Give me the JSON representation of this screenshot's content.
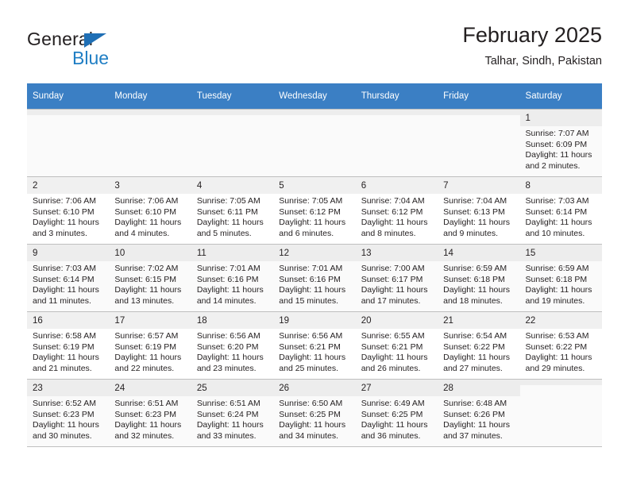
{
  "brand": {
    "name_part1": "General",
    "name_part2": "Blue",
    "logo_icon": "triangle-logo-icon"
  },
  "header": {
    "title": "February 2025",
    "subtitle": "Talhar, Sindh, Pakistan"
  },
  "calendar": {
    "weekday_headers": [
      "Sunday",
      "Monday",
      "Tuesday",
      "Wednesday",
      "Thursday",
      "Friday",
      "Saturday"
    ],
    "accent_color": "#3b7fc4",
    "weeks": [
      [
        {
          "empty": true
        },
        {
          "empty": true
        },
        {
          "empty": true
        },
        {
          "empty": true
        },
        {
          "empty": true
        },
        {
          "empty": true
        },
        {
          "day": "1",
          "sunrise": "Sunrise: 7:07 AM",
          "sunset": "Sunset: 6:09 PM",
          "daylight": "Daylight: 11 hours and 2 minutes."
        }
      ],
      [
        {
          "day": "2",
          "sunrise": "Sunrise: 7:06 AM",
          "sunset": "Sunset: 6:10 PM",
          "daylight": "Daylight: 11 hours and 3 minutes."
        },
        {
          "day": "3",
          "sunrise": "Sunrise: 7:06 AM",
          "sunset": "Sunset: 6:10 PM",
          "daylight": "Daylight: 11 hours and 4 minutes."
        },
        {
          "day": "4",
          "sunrise": "Sunrise: 7:05 AM",
          "sunset": "Sunset: 6:11 PM",
          "daylight": "Daylight: 11 hours and 5 minutes."
        },
        {
          "day": "5",
          "sunrise": "Sunrise: 7:05 AM",
          "sunset": "Sunset: 6:12 PM",
          "daylight": "Daylight: 11 hours and 6 minutes."
        },
        {
          "day": "6",
          "sunrise": "Sunrise: 7:04 AM",
          "sunset": "Sunset: 6:12 PM",
          "daylight": "Daylight: 11 hours and 8 minutes."
        },
        {
          "day": "7",
          "sunrise": "Sunrise: 7:04 AM",
          "sunset": "Sunset: 6:13 PM",
          "daylight": "Daylight: 11 hours and 9 minutes."
        },
        {
          "day": "8",
          "sunrise": "Sunrise: 7:03 AM",
          "sunset": "Sunset: 6:14 PM",
          "daylight": "Daylight: 11 hours and 10 minutes."
        }
      ],
      [
        {
          "day": "9",
          "sunrise": "Sunrise: 7:03 AM",
          "sunset": "Sunset: 6:14 PM",
          "daylight": "Daylight: 11 hours and 11 minutes."
        },
        {
          "day": "10",
          "sunrise": "Sunrise: 7:02 AM",
          "sunset": "Sunset: 6:15 PM",
          "daylight": "Daylight: 11 hours and 13 minutes."
        },
        {
          "day": "11",
          "sunrise": "Sunrise: 7:01 AM",
          "sunset": "Sunset: 6:16 PM",
          "daylight": "Daylight: 11 hours and 14 minutes."
        },
        {
          "day": "12",
          "sunrise": "Sunrise: 7:01 AM",
          "sunset": "Sunset: 6:16 PM",
          "daylight": "Daylight: 11 hours and 15 minutes."
        },
        {
          "day": "13",
          "sunrise": "Sunrise: 7:00 AM",
          "sunset": "Sunset: 6:17 PM",
          "daylight": "Daylight: 11 hours and 17 minutes."
        },
        {
          "day": "14",
          "sunrise": "Sunrise: 6:59 AM",
          "sunset": "Sunset: 6:18 PM",
          "daylight": "Daylight: 11 hours and 18 minutes."
        },
        {
          "day": "15",
          "sunrise": "Sunrise: 6:59 AM",
          "sunset": "Sunset: 6:18 PM",
          "daylight": "Daylight: 11 hours and 19 minutes."
        }
      ],
      [
        {
          "day": "16",
          "sunrise": "Sunrise: 6:58 AM",
          "sunset": "Sunset: 6:19 PM",
          "daylight": "Daylight: 11 hours and 21 minutes."
        },
        {
          "day": "17",
          "sunrise": "Sunrise: 6:57 AM",
          "sunset": "Sunset: 6:19 PM",
          "daylight": "Daylight: 11 hours and 22 minutes."
        },
        {
          "day": "18",
          "sunrise": "Sunrise: 6:56 AM",
          "sunset": "Sunset: 6:20 PM",
          "daylight": "Daylight: 11 hours and 23 minutes."
        },
        {
          "day": "19",
          "sunrise": "Sunrise: 6:56 AM",
          "sunset": "Sunset: 6:21 PM",
          "daylight": "Daylight: 11 hours and 25 minutes."
        },
        {
          "day": "20",
          "sunrise": "Sunrise: 6:55 AM",
          "sunset": "Sunset: 6:21 PM",
          "daylight": "Daylight: 11 hours and 26 minutes."
        },
        {
          "day": "21",
          "sunrise": "Sunrise: 6:54 AM",
          "sunset": "Sunset: 6:22 PM",
          "daylight": "Daylight: 11 hours and 27 minutes."
        },
        {
          "day": "22",
          "sunrise": "Sunrise: 6:53 AM",
          "sunset": "Sunset: 6:22 PM",
          "daylight": "Daylight: 11 hours and 29 minutes."
        }
      ],
      [
        {
          "day": "23",
          "sunrise": "Sunrise: 6:52 AM",
          "sunset": "Sunset: 6:23 PM",
          "daylight": "Daylight: 11 hours and 30 minutes."
        },
        {
          "day": "24",
          "sunrise": "Sunrise: 6:51 AM",
          "sunset": "Sunset: 6:23 PM",
          "daylight": "Daylight: 11 hours and 32 minutes."
        },
        {
          "day": "25",
          "sunrise": "Sunrise: 6:51 AM",
          "sunset": "Sunset: 6:24 PM",
          "daylight": "Daylight: 11 hours and 33 minutes."
        },
        {
          "day": "26",
          "sunrise": "Sunrise: 6:50 AM",
          "sunset": "Sunset: 6:25 PM",
          "daylight": "Daylight: 11 hours and 34 minutes."
        },
        {
          "day": "27",
          "sunrise": "Sunrise: 6:49 AM",
          "sunset": "Sunset: 6:25 PM",
          "daylight": "Daylight: 11 hours and 36 minutes."
        },
        {
          "day": "28",
          "sunrise": "Sunrise: 6:48 AM",
          "sunset": "Sunset: 6:26 PM",
          "daylight": "Daylight: 11 hours and 37 minutes."
        },
        {
          "empty": true
        }
      ]
    ]
  }
}
